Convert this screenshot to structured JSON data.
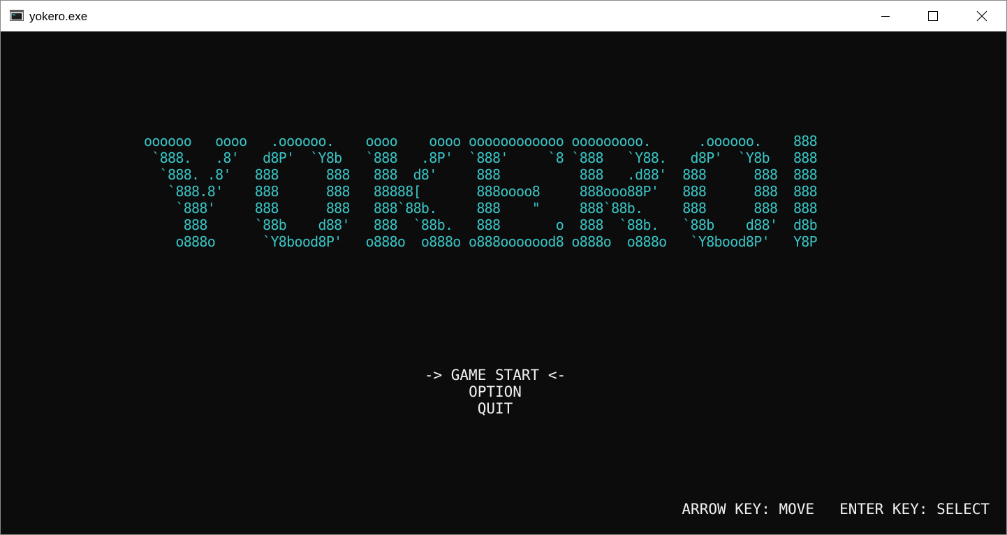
{
  "window": {
    "title": "yokero.exe",
    "icon": "console-app-icon",
    "controls": [
      "minimize-icon",
      "maximize-icon",
      "close-icon"
    ]
  },
  "logo_lines": [
    "oooooo   oooo   .oooooo.    oooo    oooo oooooooooooo ooooooooo.      .oooooo.    888",
    " `888.   .8'   d8P'  `Y8b   `888   .8P'  `888'     `8 `888   `Y88.   d8P'  `Y8b   888",
    "  `888. .8'   888      888   888  d8'     888          888   .d88'  888      888  888",
    "   `888.8'    888      888   88888[       888oooo8     888ooo88P'   888      888  888",
    "    `888'     888      888   888`88b.     888    \"     888`88b.     888      888  888",
    "     888      `88b    d88'   888  `88b.   888       o  888  `88b.   `88b    d88'  d8b",
    "    o888o      `Y8bood8P'   o888o  o888o o888ooooood8 o888o  o888o   `Y8bood8P'   Y8P"
  ],
  "menu": {
    "game_start": "-> GAME START <-",
    "option": "OPTION",
    "quit": "QUIT"
  },
  "help": {
    "move": "ARROW KEY: MOVE",
    "select": "ENTER KEY: SELECT"
  },
  "colors": {
    "logo": "#3bc4c4",
    "text": "#f2f2f2",
    "background": "#0c0c0c"
  }
}
